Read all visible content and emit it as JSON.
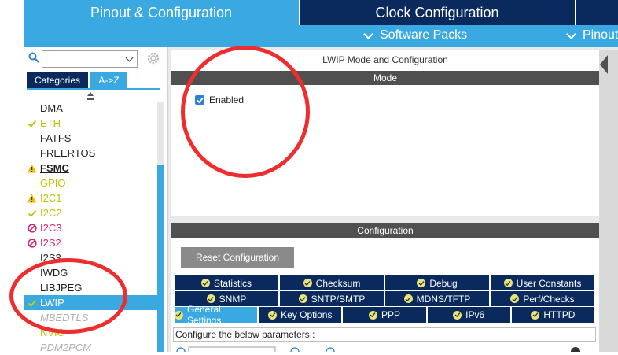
{
  "tabs": {
    "pinout": "Pinout & Configuration",
    "clock": "Clock Configuration"
  },
  "subbar": {
    "software_packs": "Software Packs",
    "pinout": "Pinout"
  },
  "left": {
    "categories_tab": "Categories",
    "az_tab": "A->Z",
    "items": [
      {
        "label": "DMA",
        "status": "none",
        "color": "dark"
      },
      {
        "label": "ETH",
        "status": "ok",
        "color": "green"
      },
      {
        "label": "FATFS",
        "status": "none",
        "color": "dark"
      },
      {
        "label": "FREERTOS",
        "status": "none",
        "color": "dark"
      },
      {
        "label": "FSMC",
        "status": "warning",
        "color": "dark"
      },
      {
        "label": "GPIO",
        "status": "none",
        "color": "green"
      },
      {
        "label": "I2C1",
        "status": "warning",
        "color": "green"
      },
      {
        "label": "I2C2",
        "status": "ok",
        "color": "green"
      },
      {
        "label": "I2C3",
        "status": "blocked",
        "color": "pink"
      },
      {
        "label": "I2S2",
        "status": "blocked",
        "color": "pink"
      },
      {
        "label": "I2S3",
        "status": "none",
        "color": "dark"
      },
      {
        "label": "IWDG",
        "status": "none",
        "color": "dark"
      },
      {
        "label": "LIBJPEG",
        "status": "none",
        "color": "dark"
      },
      {
        "label": "LWIP",
        "status": "ok",
        "color": "selected"
      },
      {
        "label": "MBEDTLS",
        "status": "none",
        "color": "gray"
      },
      {
        "label": "NVIC",
        "status": "none",
        "color": "green"
      },
      {
        "label": "PDM2PCM",
        "status": "none",
        "color": "gray"
      }
    ]
  },
  "mode": {
    "panel_title": "LWIP Mode and Configuration",
    "bar_title": "Mode",
    "enabled_label": "Enabled",
    "enabled_checked": true
  },
  "config": {
    "bar_title": "Configuration",
    "reset_button": "Reset Configuration",
    "tab_rows": [
      [
        "Statistics",
        "Checksum",
        "Debug",
        "User Constants"
      ],
      [
        "SNMP",
        "SNTP/SMTP",
        "MDNS/TFTP",
        "Perf/Checks"
      ],
      [
        "General Settings",
        "Key Options",
        "PPP",
        "IPv6",
        "HTTPD"
      ]
    ],
    "active_tab": "General Settings",
    "params_label": "Configure the below parameters :"
  },
  "colors": {
    "accent_blue": "#3aa9e2",
    "navy": "#0a2a5e",
    "annotation_red": "#ee2e2e",
    "bar_gray": "#505050"
  }
}
